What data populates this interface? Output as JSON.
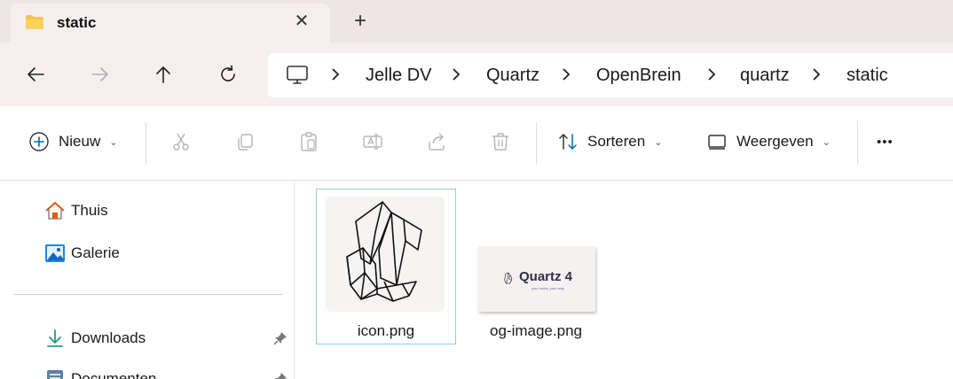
{
  "tab": {
    "title": "static",
    "folder_icon": "folder-icon",
    "close_icon": "close-icon"
  },
  "new_tab_icon": "plus-icon",
  "nav": {
    "back_icon": "arrow-left-icon",
    "forward_icon": "arrow-right-icon",
    "up_icon": "arrow-up-icon",
    "refresh_icon": "refresh-icon"
  },
  "breadcrumb": [
    "Jelle DV",
    "Quartz",
    "OpenBrein",
    "quartz",
    "static"
  ],
  "toolbar": {
    "new_label": "Nieuw",
    "sort_label": "Sorteren",
    "view_label": "Weergeven",
    "more_label": "•••",
    "caret": "⌄"
  },
  "sidebar": {
    "items": [
      {
        "label": "Thuis",
        "icon": "home-icon"
      },
      {
        "label": "Galerie",
        "icon": "gallery-icon"
      },
      {
        "label": "Downloads",
        "icon": "download-icon",
        "pinned": true
      },
      {
        "label": "Documenten",
        "icon": "documents-icon",
        "pinned": true
      }
    ]
  },
  "files": [
    {
      "name": "icon.png",
      "selected": true
    },
    {
      "name": "og-image.png",
      "selected": false,
      "thumb_text": "Quartz 4",
      "thumb_subtext": "your notes, your way"
    }
  ],
  "colors": {
    "titlebar": "#efe5e6",
    "navbar": "#f7efef",
    "accent": "#0067c0",
    "selection_border": "#8fd0dc",
    "folder": "#f4c542"
  }
}
